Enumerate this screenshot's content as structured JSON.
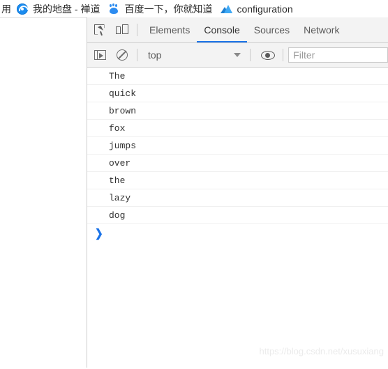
{
  "bookmarks_bar": {
    "clipped_left_text": "用",
    "items": [
      {
        "label": "我的地盘 - 禅道",
        "icon": "zentao-icon"
      },
      {
        "label": "百度一下，你就知道",
        "icon": "baidu-icon"
      },
      {
        "label": "configuration",
        "icon": "configuration-icon"
      }
    ]
  },
  "devtools": {
    "toolbar_icons": [
      {
        "name": "inspect-element-icon"
      },
      {
        "name": "device-toolbar-icon"
      }
    ],
    "tabs": [
      {
        "label": "Elements",
        "active": false
      },
      {
        "label": "Console",
        "active": true
      },
      {
        "label": "Sources",
        "active": false
      },
      {
        "label": "Network",
        "active": false
      }
    ],
    "active_tab": "Console",
    "accent_color": "#1a73e8",
    "console_toolbar": {
      "sidebar_toggle_icon": "console-sidebar-toggle-icon",
      "clear_console_icon": "clear-console-icon",
      "context_value": "top",
      "eye_icon": "live-expression-eye-icon",
      "filter_placeholder": "Filter"
    },
    "console_messages": [
      "The",
      "quick",
      "brown",
      "fox",
      "jumps",
      "over",
      "the",
      "lazy",
      "dog"
    ],
    "prompt_symbol": "❯"
  },
  "watermark": "https://blog.csdn.net/xusuxiang"
}
